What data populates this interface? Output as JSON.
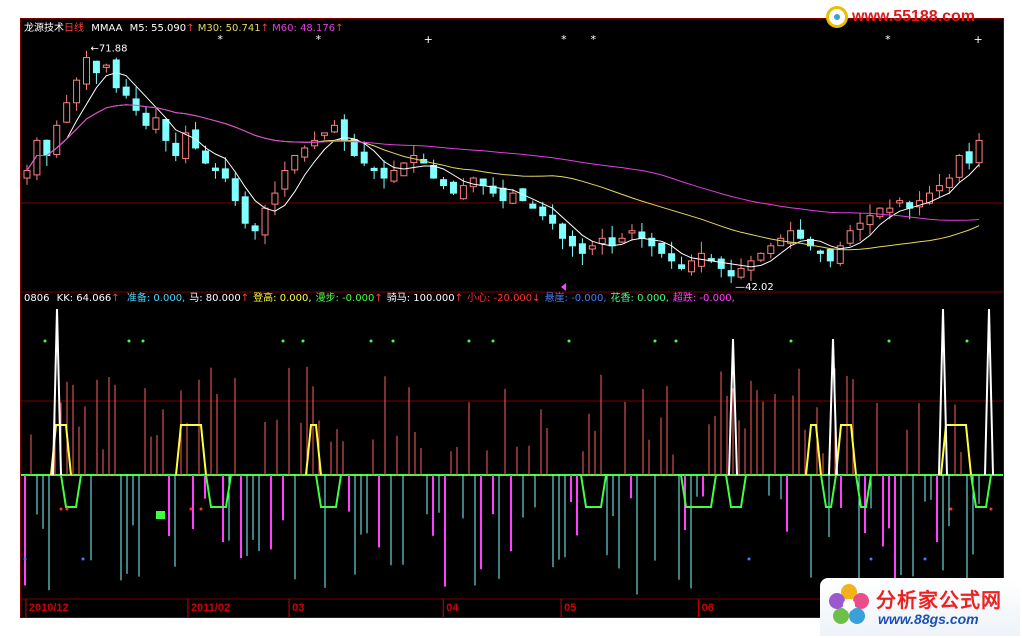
{
  "watermark": {
    "url": "www.55188.com"
  },
  "brand": {
    "name": "分析家公式网",
    "url": "www.88gs.com"
  },
  "top_panel": {
    "title": "龙源技术",
    "period": "日线",
    "mmaa": "MMAA",
    "ma5": {
      "label": "M5: 55.090",
      "arrow": "↑",
      "color": "#ffffff"
    },
    "ma30": {
      "label": "M30: 50.741",
      "arrow": "↑",
      "color": "#e8d860"
    },
    "ma60": {
      "label": "M60: 48.176",
      "arrow": "↑",
      "color": "#e040e0"
    },
    "high_label": "71.88",
    "low_label": "42.02"
  },
  "bottom_panel": {
    "code": "0806",
    "kk": {
      "label": "KK: 64.066",
      "arrow": "↑"
    },
    "items": [
      {
        "label": "准备: 0.000,",
        "color": "#40d8ff"
      },
      {
        "label": "马: 80.000",
        "arrow": "↑",
        "color": "#ffffff"
      },
      {
        "label": "登高: 0.000,",
        "color": "#ffff40"
      },
      {
        "label": "漫步: -0.000",
        "arrow": "↑",
        "color": "#40ff40"
      },
      {
        "label": "骑马: 100.000",
        "arrow": "↑",
        "color": "#ffffff"
      },
      {
        "label": "小心: -20.000",
        "arrow": "↓",
        "color": "#ff3030"
      },
      {
        "label": "悬崖: -0.000,",
        "color": "#4080ff"
      },
      {
        "label": "花香: 0.000,",
        "color": "#40ff80"
      },
      {
        "label": "超跌: -0.000,",
        "color": "#ff40ff"
      }
    ]
  },
  "time_axis": [
    {
      "label": "2010/12",
      "pos": 0.005
    },
    {
      "label": "2011/02",
      "pos": 0.17
    },
    {
      "label": "03",
      "pos": 0.273
    },
    {
      "label": "04",
      "pos": 0.43
    },
    {
      "label": "05",
      "pos": 0.55
    },
    {
      "label": "06",
      "pos": 0.69
    }
  ],
  "chart_data": {
    "type": "candlestick",
    "price_range": [
      40,
      74
    ],
    "closes": [
      56,
      60,
      58,
      62,
      65,
      68,
      71,
      69,
      70,
      67,
      66,
      64,
      62,
      63,
      60,
      58,
      61,
      59,
      57,
      56,
      55,
      52,
      49,
      48,
      51,
      53,
      56,
      58,
      59,
      60,
      61,
      62,
      60,
      58,
      57,
      56,
      55,
      56,
      57,
      58,
      57,
      55,
      54,
      53,
      54,
      55,
      54,
      53,
      52,
      53,
      52,
      51,
      50,
      49,
      47,
      46,
      45,
      46,
      47,
      46,
      47,
      48,
      47,
      46,
      45,
      44,
      43,
      44,
      45,
      44,
      43,
      42,
      43,
      44,
      45,
      46,
      47,
      48,
      47,
      46,
      45,
      44,
      46,
      48,
      49,
      50,
      51,
      51,
      52,
      51,
      52,
      53,
      54,
      55,
      58,
      57,
      60
    ]
  }
}
